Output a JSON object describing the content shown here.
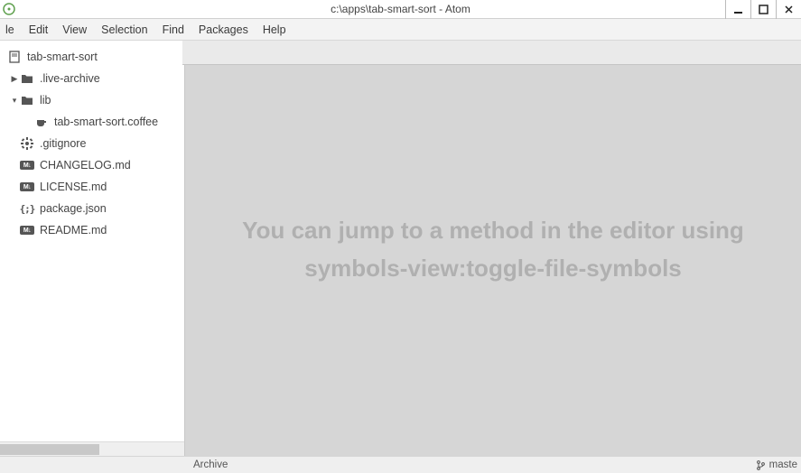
{
  "window": {
    "title": "c:\\apps\\tab-smart-sort - Atom"
  },
  "menu": {
    "file": "le",
    "edit": "Edit",
    "view": "View",
    "selection": "Selection",
    "find": "Find",
    "packages": "Packages",
    "help": "Help"
  },
  "tree": {
    "root": "tab-smart-sort",
    "live_archive": ".live-archive",
    "lib": "lib",
    "coffee_file": "tab-smart-sort.coffee",
    "gitignore": ".gitignore",
    "changelog": "CHANGELOG.md",
    "license": "LICENSE.md",
    "package": "package.json",
    "readme": "README.md"
  },
  "editor": {
    "hint": "You can jump to a method in the editor using symbols-view:toggle-file-symbols"
  },
  "status": {
    "archive": "Archive",
    "branch": "maste"
  }
}
